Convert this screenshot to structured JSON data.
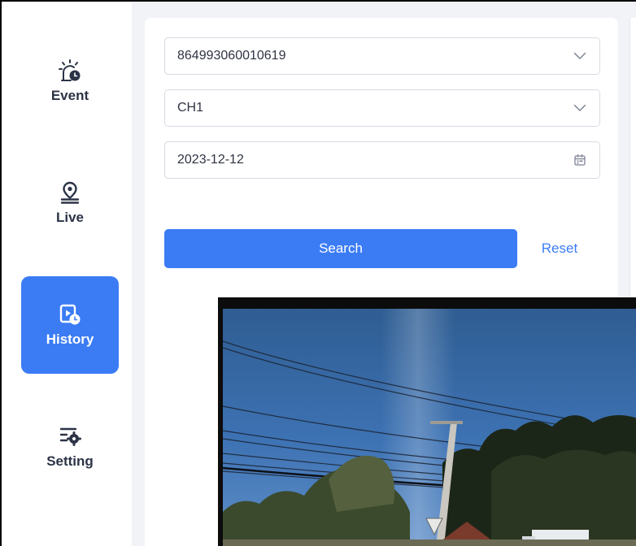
{
  "sidebar": {
    "items": [
      {
        "label": "Event",
        "icon": "alarm-light-icon",
        "active": false
      },
      {
        "label": "Live",
        "icon": "location-pin-icon",
        "active": false
      },
      {
        "label": "History",
        "icon": "video-history-icon",
        "active": true
      },
      {
        "label": "Setting",
        "icon": "settings-list-icon",
        "active": false
      }
    ]
  },
  "form": {
    "device": {
      "value": "864993060010619",
      "icon": "chevron-down-icon"
    },
    "channel": {
      "value": "CH1",
      "icon": "chevron-down-icon"
    },
    "date": {
      "value": "2023-12-12",
      "icon": "calendar-icon"
    },
    "search_label": "Search",
    "reset_label": "Reset"
  },
  "colors": {
    "accent": "#3b7cf5",
    "sidebar_text": "#2b3346",
    "background": "#f1f3f7"
  }
}
